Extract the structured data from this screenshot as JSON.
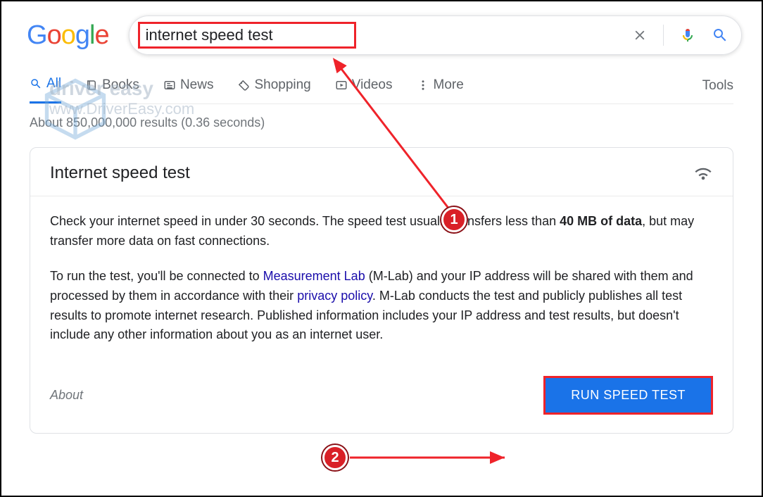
{
  "logo": [
    "G",
    "o",
    "o",
    "g",
    "l",
    "e"
  ],
  "search": {
    "value": "internet speed test"
  },
  "tabs": [
    {
      "label": "All",
      "active": true
    },
    {
      "label": "Books",
      "active": false
    },
    {
      "label": "News",
      "active": false
    },
    {
      "label": "Shopping",
      "active": false
    },
    {
      "label": "Videos",
      "active": false
    },
    {
      "label": "More",
      "active": false
    }
  ],
  "tools_label": "Tools",
  "results_meta": "About 850,000,000 results (0.36 seconds)",
  "card": {
    "title": "Internet speed test",
    "p1_prefix": "Check your internet speed in under 30 seconds. The speed test usually transfers less than ",
    "p1_bold": "40 MB of data",
    "p1_suffix": ", but may transfer more data on fast connections.",
    "p2_a": "To run the test, you'll be connected to ",
    "p2_link1": "Measurement Lab",
    "p2_b": " (M-Lab) and your IP address will be shared with them and processed by them in accordance with their ",
    "p2_link2": "privacy policy",
    "p2_c": ". M-Lab conducts the test and publicly publishes all test results to promote internet research. Published information includes your IP address and test results, but doesn't include any other information about you as an internet user.",
    "about": "About",
    "run": "RUN SPEED TEST"
  },
  "annotations": {
    "badge1": "1",
    "badge2": "2"
  },
  "watermark": {
    "line1": "driver easy",
    "line2": "www.DriverEasy.com"
  }
}
